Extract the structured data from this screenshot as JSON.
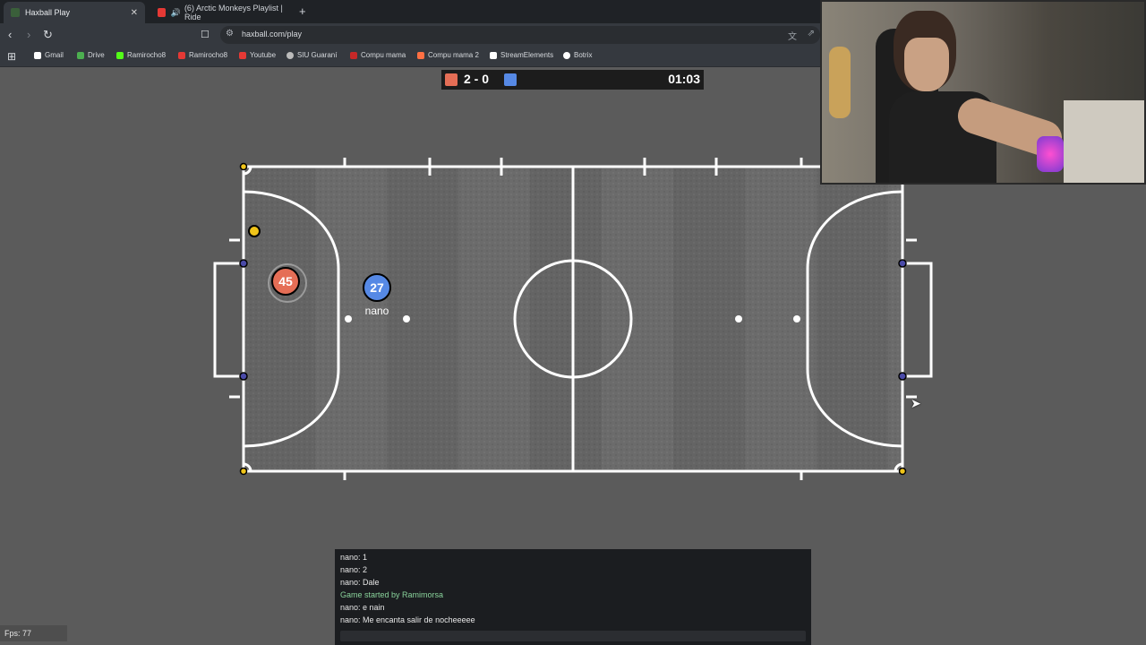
{
  "browser": {
    "tabs": [
      {
        "label": "Haxball Play",
        "active": true,
        "favicon_color": "#3a5f3a"
      },
      {
        "label": "(6) Arctic Monkeys Playlist | Ride",
        "active": false,
        "favicon_color": "#e53935",
        "icon": "speaker-icon"
      }
    ],
    "new_tab": "+",
    "close": "✕",
    "url": "haxball.com/play",
    "bookmarks": [
      {
        "label": "Gmail",
        "color": "#ffffff"
      },
      {
        "label": "Drive",
        "color": "#4caf50"
      },
      {
        "label": "Ramirocho8",
        "color": "#53fc18"
      },
      {
        "label": "Ramirocho8",
        "color": "#e53935"
      },
      {
        "label": "Youtube",
        "color": "#e53935"
      },
      {
        "label": "SIU Guaraní",
        "color": "#bbbbbb"
      },
      {
        "label": "Compu mama",
        "color": "#c62828"
      },
      {
        "label": "Compu mama 2",
        "color": "#ff7043"
      },
      {
        "label": "StreamElements",
        "color": "#ffffff"
      },
      {
        "label": "Botrix",
        "color": "#ffffff"
      }
    ]
  },
  "game": {
    "score": "2 - 0",
    "time": "01:03",
    "red_color": "#e56e56",
    "blue_color": "#5689e5",
    "red_player": {
      "number": "45"
    },
    "blue_player": {
      "number": "27",
      "name": "nano"
    }
  },
  "chat": {
    "messages": [
      {
        "text": "nano: 1",
        "type": "msg"
      },
      {
        "text": "nano: 2",
        "type": "msg"
      },
      {
        "text": "nano: Dale",
        "type": "msg"
      },
      {
        "text": "Game started by Ramimorsa",
        "type": "notice"
      },
      {
        "text": "nano: e nain",
        "type": "msg"
      },
      {
        "text": "nano: Me encanta salir de nocheeeee",
        "type": "msg"
      }
    ]
  },
  "fps": "Fps: 77"
}
